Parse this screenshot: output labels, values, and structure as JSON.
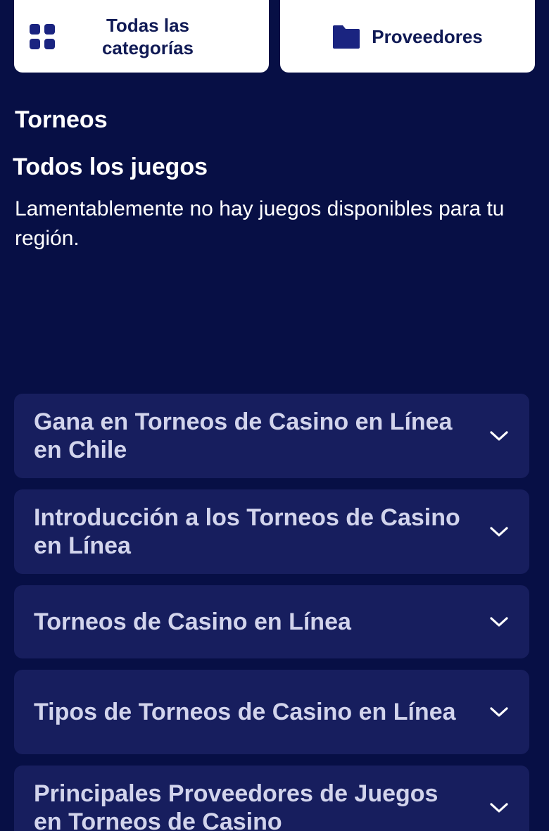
{
  "top_buttons": {
    "categories": {
      "label": "Todas las categorías",
      "icon": "grid-icon"
    },
    "providers": {
      "label": "Proveedores",
      "icon": "folder-icon"
    }
  },
  "section": {
    "heading": "Torneos",
    "title": "Todos los juegos",
    "empty_message": "Lamentablemente no hay juegos disponibles para tu región."
  },
  "faq": {
    "items": [
      {
        "question": "Gana en Torneos de Casino en Línea en Chile",
        "icon": "chevron-down-icon"
      },
      {
        "question": "Introducción a los Torneos de Casino en Línea",
        "icon": "chevron-down-icon"
      },
      {
        "question": "Torneos de Casino en Línea",
        "icon": "chevron-down-icon"
      },
      {
        "question": "Tipos de Torneos de Casino en Línea",
        "icon": "chevron-down-icon"
      },
      {
        "question": "Principales Proveedores de Juegos en Torneos de Casino",
        "icon": "chevron-down-icon"
      }
    ]
  },
  "colors": {
    "background": "#070f45",
    "card": "#171e5e",
    "button_bg": "#ffffff",
    "button_text": "#101a55",
    "icon": "#1a2480",
    "faq_text": "#d2d4ec"
  }
}
